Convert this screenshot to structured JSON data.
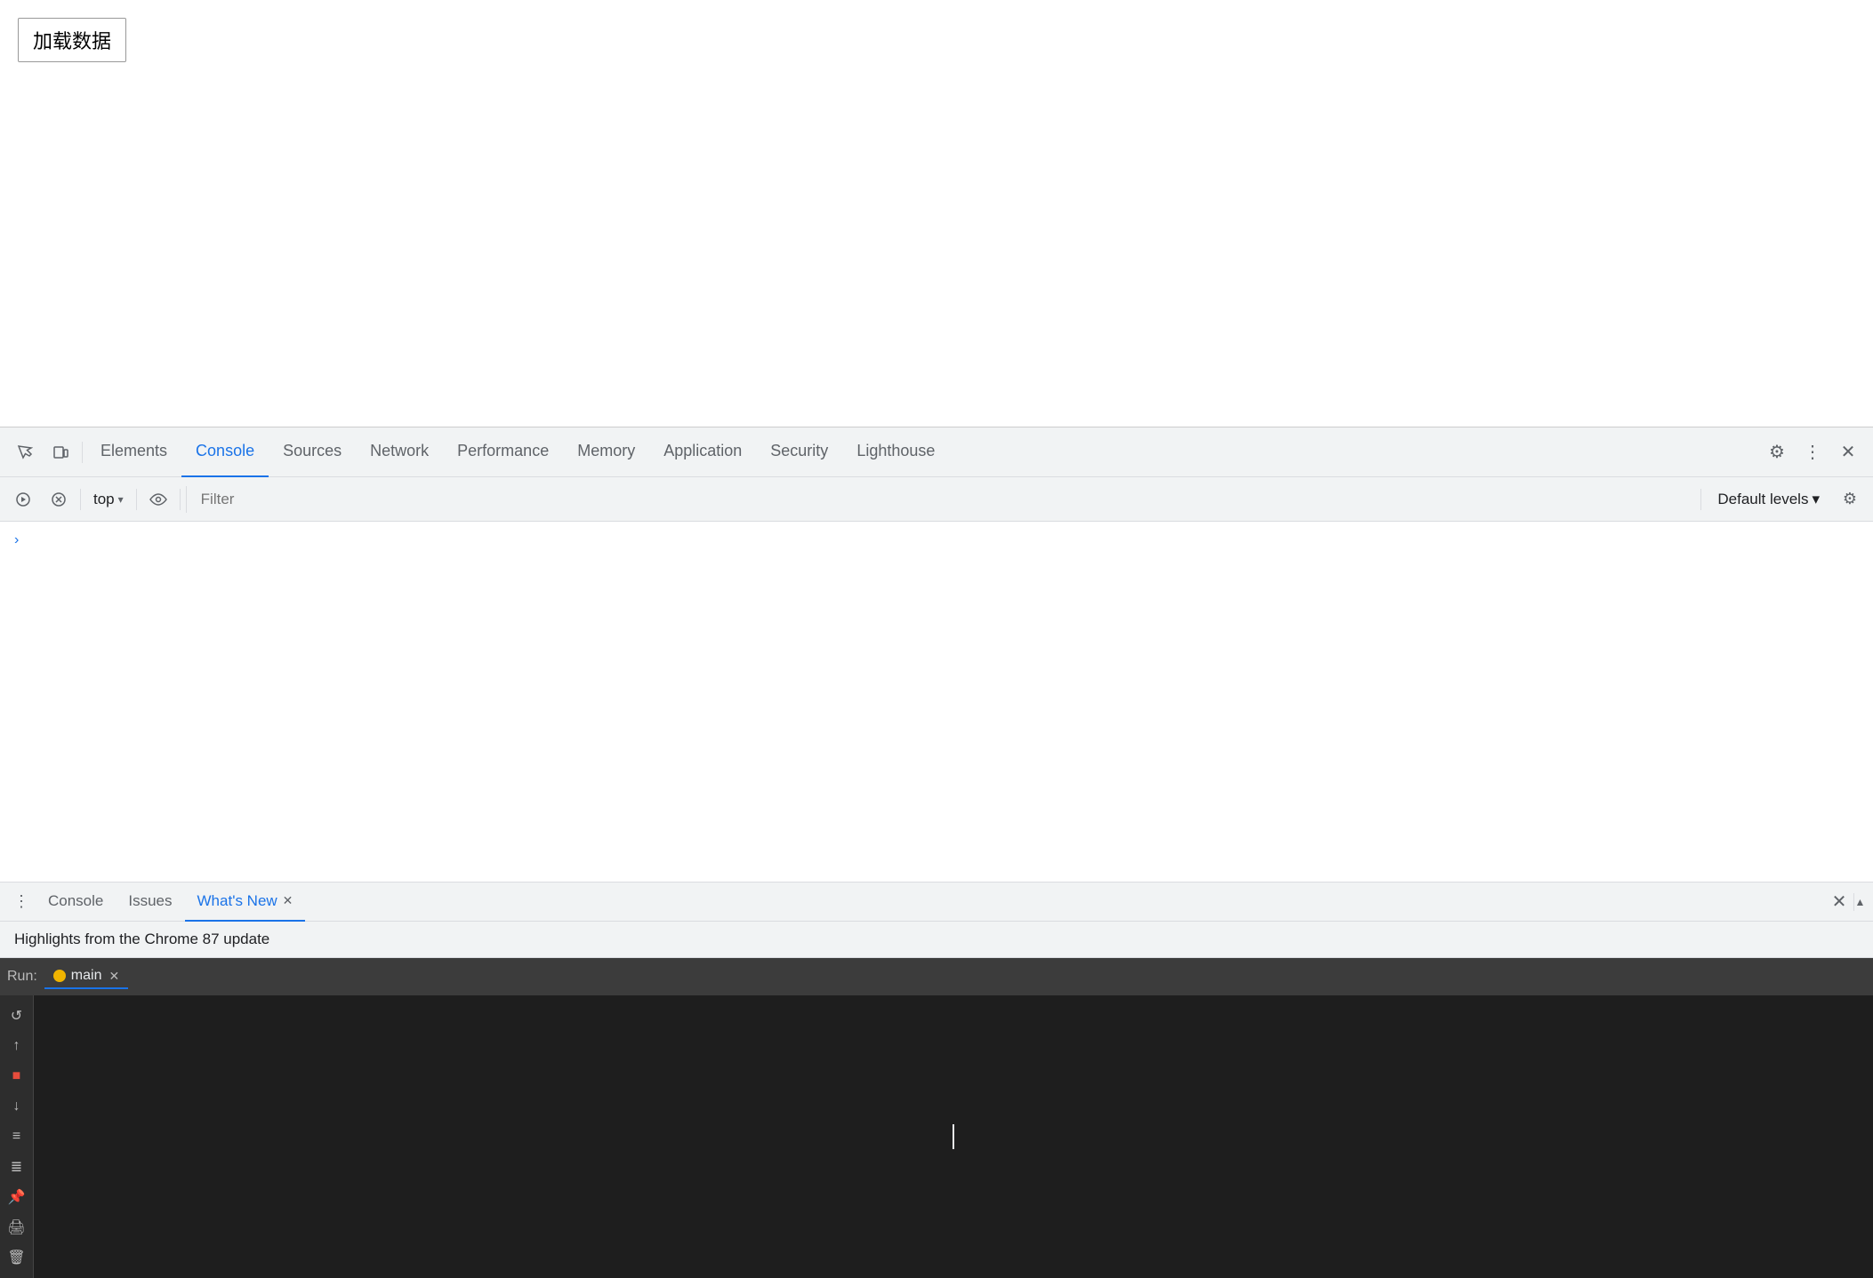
{
  "page": {
    "button_label": "加载数据"
  },
  "devtools": {
    "tabs": [
      {
        "label": "Elements",
        "active": false
      },
      {
        "label": "Console",
        "active": true
      },
      {
        "label": "Sources",
        "active": false
      },
      {
        "label": "Network",
        "active": false
      },
      {
        "label": "Performance",
        "active": false
      },
      {
        "label": "Memory",
        "active": false
      },
      {
        "label": "Application",
        "active": false
      },
      {
        "label": "Security",
        "active": false
      },
      {
        "label": "Lighthouse",
        "active": false
      }
    ],
    "console_toolbar": {
      "context": "top",
      "filter_placeholder": "Filter",
      "levels_label": "Default levels"
    },
    "bottom_panel": {
      "tabs": [
        {
          "label": "Console",
          "active": false,
          "closeable": false
        },
        {
          "label": "Issues",
          "active": false,
          "closeable": false
        },
        {
          "label": "What's New",
          "active": true,
          "closeable": true
        }
      ],
      "whats_new_header": "Highlights from the Chrome 87 update"
    },
    "run_panel": {
      "run_label": "Run:",
      "main_tab": "main"
    }
  },
  "icons": {
    "inspect": "⬚",
    "device": "⊡",
    "gear": "⚙",
    "more": "⋮",
    "close": "✕",
    "play": "▷",
    "stop": "■",
    "clear": "🚫",
    "eye": "◉",
    "chevron_down": "▾",
    "step_over": "↩",
    "step_into": "↓",
    "step_out": "↑",
    "pause": "⏸",
    "resume": "▶",
    "pin": "📌",
    "print": "🖨",
    "trash": "🗑",
    "scroll_up": "▲",
    "scroll_down": "▼"
  }
}
